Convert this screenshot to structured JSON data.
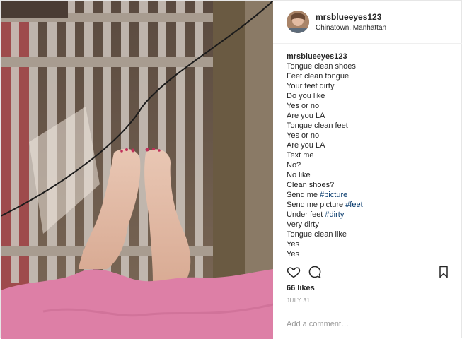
{
  "post": {
    "username": "mrsblueeyes123",
    "location": "Chinatown, Manhattan",
    "caption": {
      "username": "mrsblueeyes123",
      "lines": [
        [
          {
            "t": "Tongue clean shoes"
          }
        ],
        [
          {
            "t": "Feet clean tongue"
          }
        ],
        [
          {
            "t": "Your feet dirty"
          }
        ],
        [
          {
            "t": "Do you like"
          }
        ],
        [
          {
            "t": "Yes or no"
          }
        ],
        [
          {
            "t": "Are you LA"
          }
        ],
        [
          {
            "t": "Tongue clean feet"
          }
        ],
        [
          {
            "t": "Yes or no"
          }
        ],
        [
          {
            "t": "Are you LA"
          }
        ],
        [
          {
            "t": "Text me"
          }
        ],
        [
          {
            "t": "No?"
          }
        ],
        [
          {
            "t": "No like"
          }
        ],
        [
          {
            "t": "Clean shoes?"
          }
        ],
        [
          {
            "t": "Send me "
          },
          {
            "t": "#picture",
            "tag": true
          }
        ],
        [
          {
            "t": "Send me picture "
          },
          {
            "t": "#feet",
            "tag": true
          }
        ],
        [
          {
            "t": "Under feet "
          },
          {
            "t": "#dirty",
            "tag": true
          }
        ],
        [
          {
            "t": "Very dirty"
          }
        ],
        [
          {
            "t": "Tongue clean like"
          }
        ],
        [
          {
            "t": "Yes"
          }
        ],
        [
          {
            "t": "Yes"
          }
        ]
      ]
    },
    "actions": {
      "like_icon": "heart-outline-icon",
      "comment_icon": "comment-bubble-icon",
      "save_icon": "bookmark-icon"
    },
    "likes": "66 likes",
    "date": "JULY 31",
    "comment_placeholder": "Add a comment…"
  },
  "colors": {
    "hashtag": "#003569",
    "muted": "#999999",
    "text": "#262626"
  }
}
